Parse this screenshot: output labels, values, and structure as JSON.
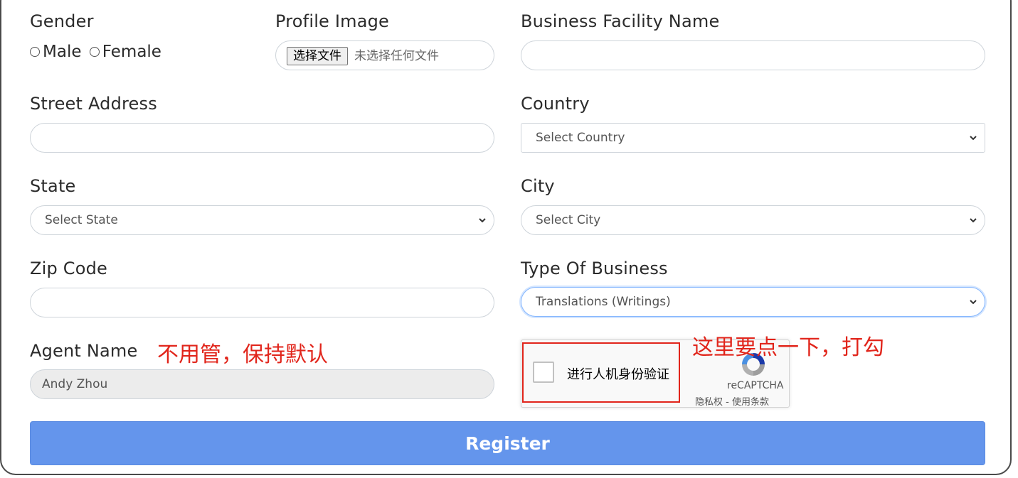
{
  "gender": {
    "label": "Gender",
    "options": [
      "Male",
      "Female"
    ]
  },
  "profile_image": {
    "label": "Profile Image",
    "button": "选择文件",
    "status": "未选择任何文件"
  },
  "business_facility": {
    "label": "Business Facility Name",
    "value": ""
  },
  "street_address": {
    "label": "Street Address",
    "value": ""
  },
  "country": {
    "label": "Country",
    "selected": "Select Country"
  },
  "state": {
    "label": "State",
    "selected": "Select State"
  },
  "city": {
    "label": "City",
    "selected": "Select City"
  },
  "zip_code": {
    "label": "Zip Code",
    "value": ""
  },
  "type_of_business": {
    "label": "Type Of Business",
    "selected": "Translations (Writings)"
  },
  "agent_name": {
    "label": "Agent Name",
    "value": "Andy Zhou"
  },
  "annotations": {
    "agent_note": "不用管，保持默认",
    "captcha_note": "这里要点一下，打勾"
  },
  "recaptcha": {
    "label": "进行人机身份验证",
    "brand": "reCAPTCHA",
    "links": "隐私权 - 使用条款"
  },
  "register_button": "Register",
  "colors": {
    "accent": "#6495ec",
    "annotation": "#e1251b",
    "focus_border": "#86b7fe"
  }
}
